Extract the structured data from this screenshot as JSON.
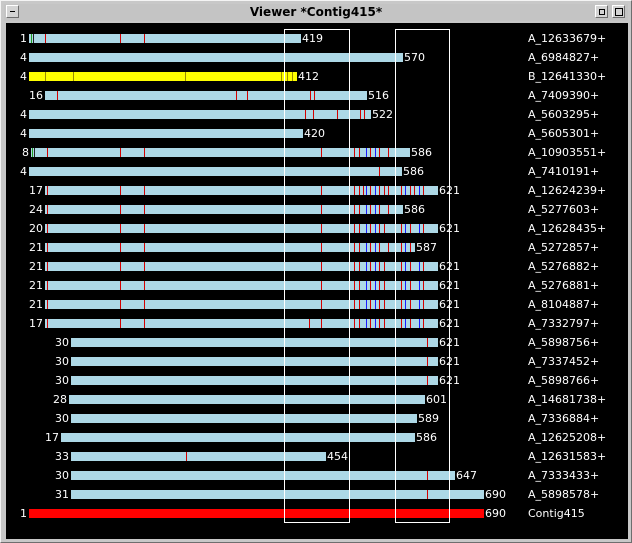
{
  "window": {
    "title": "Viewer *Contig415*"
  },
  "colors": {
    "read": "#add8e6",
    "highlight": "#ffff00",
    "contig": "#ff0000",
    "snp": "#d40000",
    "snp_alt": "#1a1aff",
    "background": "#000000"
  },
  "rows": [
    {
      "num": "1",
      "len": "419",
      "name": "A_12633679+",
      "start": 1,
      "end": 273,
      "color": "read",
      "marks": [
        [
          3,
          "g"
        ],
        [
          5,
          "k"
        ],
        [
          17,
          "r"
        ],
        [
          92,
          "r"
        ],
        [
          116,
          "r"
        ]
      ]
    },
    {
      "num": "4",
      "len": "570",
      "name": "A_6984827+",
      "start": 1,
      "end": 375,
      "color": "read",
      "marks": []
    },
    {
      "num": "4",
      "len": "412",
      "name": "B_12641330+",
      "start": 1,
      "end": 269,
      "color": "highlight",
      "marks": [
        [
          17,
          "y"
        ],
        [
          45,
          "y"
        ],
        [
          157,
          "y"
        ],
        [
          253,
          "y"
        ],
        [
          259,
          "y"
        ],
        [
          264,
          "y"
        ]
      ]
    },
    {
      "num": "16",
      "len": "516",
      "name": "A_7409390+",
      "start": 17,
      "end": 339,
      "color": "read",
      "marks": [
        [
          29,
          "r"
        ],
        [
          208,
          "r"
        ],
        [
          219,
          "r"
        ],
        [
          282,
          "r"
        ],
        [
          286,
          "r"
        ]
      ]
    },
    {
      "num": "4",
      "len": "522",
      "name": "A_5603295+",
      "start": 1,
      "end": 343,
      "color": "read",
      "marks": [
        [
          277,
          "r"
        ],
        [
          285,
          "r"
        ],
        [
          309,
          "r"
        ],
        [
          332,
          "r"
        ],
        [
          336,
          "r"
        ]
      ]
    },
    {
      "num": "4",
      "len": "420",
      "name": "A_5605301+",
      "start": 1,
      "end": 275,
      "color": "read",
      "marks": []
    },
    {
      "num": "8",
      "len": "586",
      "name": "A_10903551+",
      "start": 3,
      "end": 382,
      "color": "read",
      "marks": [
        [
          4,
          "g"
        ],
        [
          6,
          "k"
        ],
        [
          19,
          "r"
        ],
        [
          92,
          "r"
        ],
        [
          116,
          "r"
        ],
        [
          293,
          "r"
        ],
        [
          321,
          "b"
        ],
        [
          326,
          "r"
        ],
        [
          331,
          "r"
        ],
        [
          338,
          "b"
        ],
        [
          342,
          "r"
        ],
        [
          347,
          "b"
        ],
        [
          351,
          "r"
        ],
        [
          360,
          "r"
        ]
      ]
    },
    {
      "num": "4",
      "len": "586",
      "name": "A_7410191+",
      "start": 1,
      "end": 374,
      "color": "read",
      "marks": [
        [
          351,
          "r"
        ]
      ]
    },
    {
      "num": "17",
      "len": "621",
      "name": "A_12624239+",
      "start": 17,
      "end": 410,
      "color": "read",
      "marks": [
        [
          19,
          "r"
        ],
        [
          92,
          "r"
        ],
        [
          116,
          "r"
        ],
        [
          293,
          "r"
        ],
        [
          321,
          "b"
        ],
        [
          326,
          "r"
        ],
        [
          331,
          "r"
        ],
        [
          335,
          "r"
        ],
        [
          338,
          "b"
        ],
        [
          342,
          "r"
        ],
        [
          347,
          "b"
        ],
        [
          351,
          "r"
        ],
        [
          356,
          "r"
        ],
        [
          360,
          "r"
        ],
        [
          373,
          "r"
        ],
        [
          377,
          "b"
        ],
        [
          382,
          "r"
        ],
        [
          386,
          "r"
        ],
        [
          391,
          "b"
        ],
        [
          395,
          "r"
        ]
      ]
    },
    {
      "num": "24",
      "len": "586",
      "name": "A_5277603+",
      "start": 17,
      "end": 375,
      "color": "read",
      "marks": [
        [
          19,
          "r"
        ],
        [
          92,
          "r"
        ],
        [
          116,
          "r"
        ],
        [
          293,
          "r"
        ],
        [
          321,
          "b"
        ],
        [
          326,
          "r"
        ],
        [
          331,
          "r"
        ],
        [
          338,
          "b"
        ],
        [
          342,
          "r"
        ],
        [
          347,
          "b"
        ],
        [
          351,
          "r"
        ],
        [
          360,
          "r"
        ]
      ]
    },
    {
      "num": "20",
      "len": "621",
      "name": "A_12628435+",
      "start": 17,
      "end": 410,
      "color": "read",
      "marks": [
        [
          19,
          "r"
        ],
        [
          92,
          "r"
        ],
        [
          116,
          "r"
        ],
        [
          293,
          "r"
        ],
        [
          321,
          "b"
        ],
        [
          326,
          "r"
        ],
        [
          331,
          "r"
        ],
        [
          338,
          "b"
        ],
        [
          342,
          "r"
        ],
        [
          347,
          "b"
        ],
        [
          351,
          "r"
        ],
        [
          356,
          "r"
        ],
        [
          373,
          "r"
        ],
        [
          377,
          "b"
        ],
        [
          382,
          "r"
        ],
        [
          391,
          "b"
        ],
        [
          395,
          "r"
        ]
      ]
    },
    {
      "num": "21",
      "len": "587",
      "name": "A_5272857+",
      "start": 17,
      "end": 387,
      "color": "read",
      "marks": [
        [
          19,
          "r"
        ],
        [
          92,
          "r"
        ],
        [
          116,
          "r"
        ],
        [
          293,
          "r"
        ],
        [
          321,
          "b"
        ],
        [
          326,
          "r"
        ],
        [
          331,
          "r"
        ],
        [
          338,
          "b"
        ],
        [
          342,
          "r"
        ],
        [
          347,
          "b"
        ],
        [
          351,
          "r"
        ],
        [
          360,
          "r"
        ],
        [
          373,
          "r"
        ],
        [
          377,
          "b"
        ],
        [
          382,
          "r"
        ]
      ]
    },
    {
      "num": "21",
      "len": "621",
      "name": "A_5276882+",
      "start": 17,
      "end": 410,
      "color": "read",
      "marks": [
        [
          19,
          "r"
        ],
        [
          92,
          "r"
        ],
        [
          116,
          "r"
        ],
        [
          293,
          "r"
        ],
        [
          321,
          "b"
        ],
        [
          326,
          "r"
        ],
        [
          331,
          "r"
        ],
        [
          338,
          "b"
        ],
        [
          342,
          "r"
        ],
        [
          347,
          "b"
        ],
        [
          351,
          "r"
        ],
        [
          356,
          "r"
        ],
        [
          373,
          "r"
        ],
        [
          377,
          "b"
        ],
        [
          382,
          "r"
        ],
        [
          391,
          "b"
        ],
        [
          395,
          "r"
        ]
      ]
    },
    {
      "num": "21",
      "len": "621",
      "name": "A_5276881+",
      "start": 17,
      "end": 410,
      "color": "read",
      "marks": [
        [
          19,
          "r"
        ],
        [
          92,
          "r"
        ],
        [
          116,
          "r"
        ],
        [
          293,
          "r"
        ],
        [
          321,
          "b"
        ],
        [
          326,
          "r"
        ],
        [
          331,
          "r"
        ],
        [
          338,
          "b"
        ],
        [
          342,
          "r"
        ],
        [
          347,
          "b"
        ],
        [
          351,
          "r"
        ],
        [
          356,
          "r"
        ],
        [
          373,
          "r"
        ],
        [
          377,
          "b"
        ],
        [
          382,
          "r"
        ],
        [
          391,
          "b"
        ],
        [
          395,
          "r"
        ]
      ]
    },
    {
      "num": "21",
      "len": "621",
      "name": "A_8104887+",
      "start": 17,
      "end": 410,
      "color": "read",
      "marks": [
        [
          19,
          "r"
        ],
        [
          92,
          "r"
        ],
        [
          116,
          "r"
        ],
        [
          293,
          "r"
        ],
        [
          321,
          "b"
        ],
        [
          326,
          "r"
        ],
        [
          331,
          "r"
        ],
        [
          338,
          "b"
        ],
        [
          342,
          "r"
        ],
        [
          347,
          "b"
        ],
        [
          351,
          "r"
        ],
        [
          356,
          "r"
        ],
        [
          373,
          "r"
        ],
        [
          377,
          "b"
        ],
        [
          382,
          "r"
        ],
        [
          391,
          "b"
        ],
        [
          395,
          "r"
        ]
      ]
    },
    {
      "num": "17",
      "len": "621",
      "name": "A_7332797+",
      "start": 17,
      "end": 410,
      "color": "read",
      "marks": [
        [
          19,
          "r"
        ],
        [
          92,
          "r"
        ],
        [
          116,
          "r"
        ],
        [
          281,
          "r"
        ],
        [
          293,
          "r"
        ],
        [
          321,
          "b"
        ],
        [
          326,
          "r"
        ],
        [
          331,
          "r"
        ],
        [
          338,
          "b"
        ],
        [
          342,
          "r"
        ],
        [
          347,
          "b"
        ],
        [
          351,
          "r"
        ],
        [
          356,
          "r"
        ],
        [
          373,
          "r"
        ],
        [
          377,
          "b"
        ],
        [
          382,
          "r"
        ],
        [
          391,
          "b"
        ],
        [
          395,
          "r"
        ]
      ]
    },
    {
      "num": "30",
      "len": "621",
      "name": "A_5898756+",
      "start": 43,
      "end": 410,
      "color": "read",
      "marks": [
        [
          399,
          "r"
        ]
      ]
    },
    {
      "num": "30",
      "len": "621",
      "name": "A_7337452+",
      "start": 43,
      "end": 410,
      "color": "read",
      "marks": [
        [
          399,
          "r"
        ]
      ]
    },
    {
      "num": "30",
      "len": "621",
      "name": "A_5898766+",
      "start": 43,
      "end": 410,
      "color": "read",
      "marks": [
        [
          399,
          "r"
        ]
      ]
    },
    {
      "num": "28",
      "len": "601",
      "name": "A_14681738+",
      "start": 41,
      "end": 397,
      "color": "read",
      "marks": []
    },
    {
      "num": "30",
      "len": "589",
      "name": "A_7336884+",
      "start": 43,
      "end": 389,
      "color": "read",
      "marks": []
    },
    {
      "num": "17",
      "len": "586",
      "name": "A_12625208+",
      "start": 33,
      "end": 387,
      "color": "read",
      "marks": []
    },
    {
      "num": "33",
      "len": "454",
      "name": "A_12631583+",
      "start": 43,
      "end": 298,
      "color": "read",
      "marks": [
        [
          158,
          "r"
        ]
      ]
    },
    {
      "num": "30",
      "len": "647",
      "name": "A_7333433+",
      "start": 43,
      "end": 427,
      "color": "read",
      "marks": [
        [
          399,
          "r"
        ]
      ]
    },
    {
      "num": "31",
      "len": "690",
      "name": "A_5898578+",
      "start": 43,
      "end": 456,
      "color": "read",
      "marks": [
        [
          399,
          "r"
        ]
      ]
    },
    {
      "num": "1",
      "len": "690",
      "name": "Contig415",
      "start": 1,
      "end": 456,
      "color": "contig",
      "marks": []
    }
  ]
}
